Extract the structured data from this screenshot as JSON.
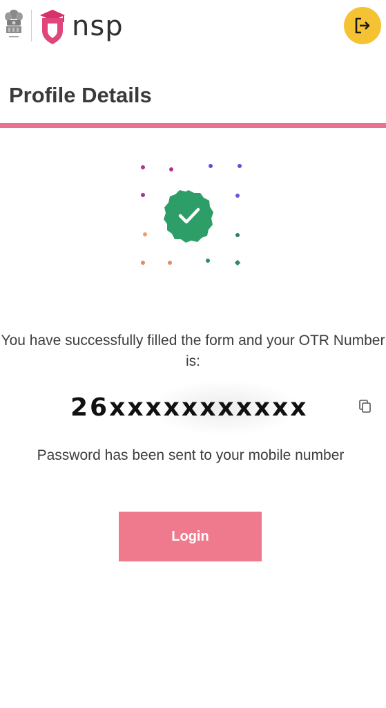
{
  "header": {
    "brand": "nsp",
    "emblem_icon": "national-emblem-icon",
    "logo_icon": "graduation-shield-icon",
    "logout_icon": "logout-icon",
    "logout_color": "#f5c233"
  },
  "page": {
    "title": "Profile Details",
    "accent_color": "#e8728f"
  },
  "success": {
    "icon": "check-badge-icon",
    "badge_color": "#2e9e68",
    "message": "You have successfully filled the form and your OTR Number is:",
    "otr_number": "26xxxxxxxxxxx",
    "copy_icon": "copy-icon",
    "password_note": "Password has been sent to your mobile number"
  },
  "actions": {
    "login_label": "Login",
    "login_color": "#f07a8d"
  }
}
